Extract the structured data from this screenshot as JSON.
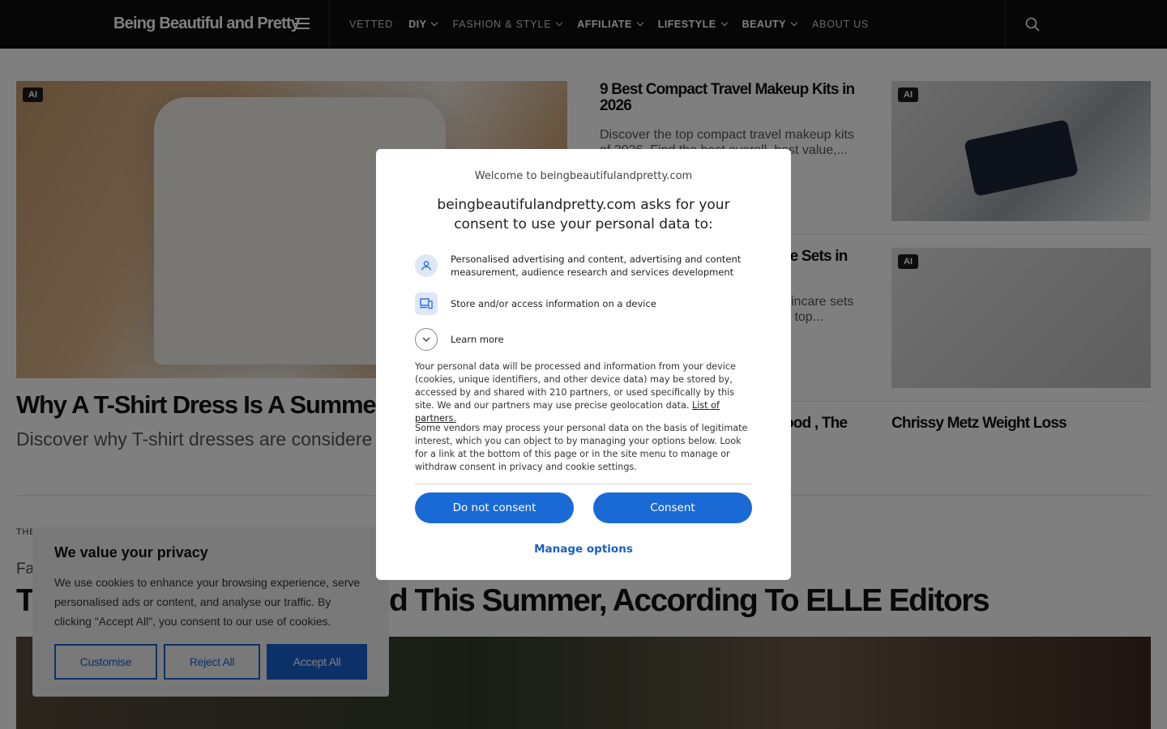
{
  "header": {
    "logo": "Being Beautiful and Pretty",
    "nav": [
      {
        "label": "VETTED",
        "dropdown": false,
        "bold": false
      },
      {
        "label": "DIY",
        "dropdown": true,
        "bold": true
      },
      {
        "label": "FASHION & STYLE",
        "dropdown": true,
        "bold": false
      },
      {
        "label": "AFFILIATE",
        "dropdown": true,
        "bold": true
      },
      {
        "label": "LIFESTYLE",
        "dropdown": true,
        "bold": true
      },
      {
        "label": "BEAUTY",
        "dropdown": true,
        "bold": true
      },
      {
        "label": "ABOUT US",
        "dropdown": false,
        "bold": false
      }
    ]
  },
  "articles": {
    "main": {
      "badge": "AI",
      "title": "Why A T-Shirt Dress Is A Summer-t",
      "excerpt": "Discover why T-shirt dresses are considere wardrobe staple for..."
    },
    "side1": {
      "badge": "AI",
      "title": "9 Best Compact Travel Makeup Kits in 2026",
      "excerpt": "Discover the top compact travel makeup kits of 2026. Find the best overall, best value,..."
    },
    "side2": {
      "badge": "AI",
      "title": "re Sets in",
      "excerpt_line1": "kincare sets",
      "excerpt_line2": "s top..."
    },
    "side3_partial": "ood , The",
    "side4": "Chrissy Metz Weight Loss",
    "section_label": "THE",
    "category": "Fa",
    "big_title_left": "T",
    "big_title_right": "d This Summer, According To ELLE Editors"
  },
  "consent_dialog": {
    "welcome": "Welcome to beingbeautifulandpretty.com",
    "title": "beingbeautifulandpretty.com asks for your consent to use your personal data to:",
    "purpose1": "Personalised advertising and content, advertising and content measurement, audience research and services development",
    "purpose2": "Store and/or access information on a device",
    "learn_more": "Learn more",
    "body1": "Your personal data will be processed and information from your device (cookies, unique identifiers, and other device data) may be stored by, accessed by and shared with 210 partners, or used specifically by this site. We and our partners may use precise geolocation data.",
    "partners_link": "List of partners.",
    "body2": "Some vendors may process your personal data on the basis of legitimate interest, which you can object to by managing your options below. Look for a link at the bottom of this page or in the site menu to manage or withdraw consent in privacy and cookie settings.",
    "btn_do_not_consent": "Do not consent",
    "btn_consent": "Consent",
    "manage_options": "Manage options"
  },
  "cookie_banner": {
    "title": "We value your privacy",
    "text": "We use cookies to enhance your browsing experience, serve personalised ads or content, and analyse our traffic. By clicking \"Accept All\", you consent to our use of cookies.",
    "btn_customise": "Customise",
    "btn_reject": "Reject All",
    "btn_accept": "Accept All"
  },
  "colors": {
    "header_bg": "#0d0d0d",
    "consent_blue": "#1a6ad6",
    "cookie_blue": "#1862d0",
    "overlay": "rgba(0,0,0,0.5)"
  },
  "icons": [
    "menu-icon",
    "search-icon",
    "chevron-down-icon",
    "person-icon",
    "devices-icon"
  ]
}
